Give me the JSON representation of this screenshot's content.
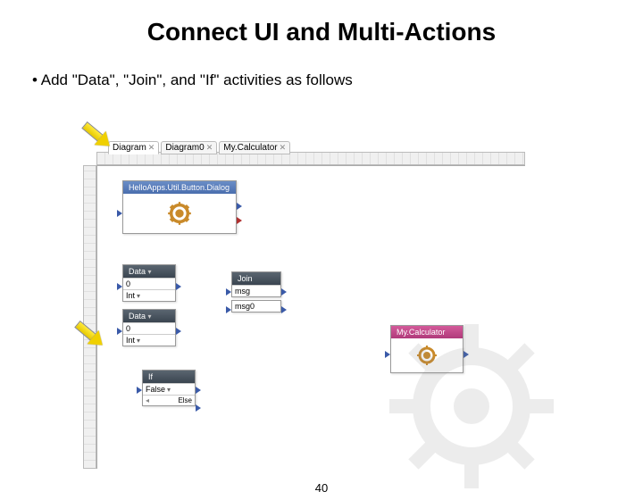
{
  "title": "Connect UI and Multi-Actions",
  "bullet": "Add \"Data\", \"Join\", and \"If\" activities as follows",
  "tabs": [
    {
      "label": "Diagram",
      "active": true
    },
    {
      "label": "Diagram0",
      "active": false
    },
    {
      "label": "My.Calculator",
      "active": false
    }
  ],
  "nodes": {
    "dialog": {
      "title": "HelloApps.Util.Button.Dialog"
    },
    "data1": {
      "title": "Data",
      "value": "0",
      "type": "Int"
    },
    "data2": {
      "title": "Data",
      "value": "0",
      "type": "Int"
    },
    "join": {
      "title": "Join",
      "line1": "msg",
      "line2": "msg0"
    },
    "if": {
      "title": "If",
      "value": "False",
      "else": "Else"
    },
    "calc": {
      "title": "My.Calculator"
    }
  },
  "pagenum": "40"
}
